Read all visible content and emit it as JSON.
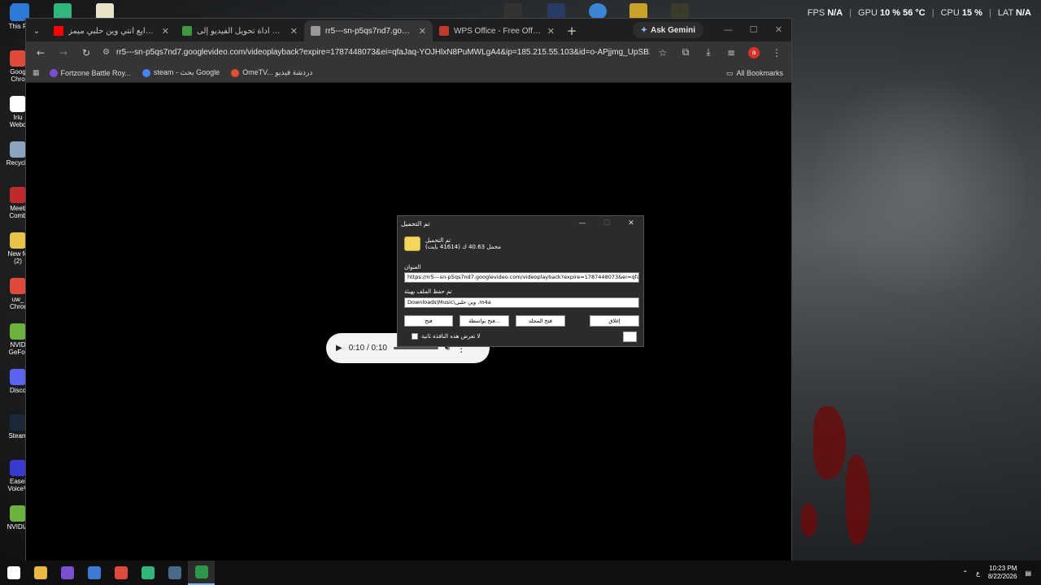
{
  "desktop": {
    "icons": [
      {
        "label": "This P",
        "icon": "pc-icon",
        "color": "#2d7bd6"
      },
      {
        "label": "Goog\nChro",
        "icon": "chrome-icon",
        "color": "#e04a3a"
      },
      {
        "label": "Iriu\nWebc",
        "icon": "webcam-icon",
        "color": "#ffffff"
      },
      {
        "label": "Recycle",
        "icon": "recycle-bin-icon",
        "color": "#8aa4c0"
      },
      {
        "label": "Meeti\nComb",
        "icon": "app-icon",
        "color": "#c02a2a"
      },
      {
        "label": "New fo\n(2)",
        "icon": "folder-icon",
        "color": "#e8c34a"
      },
      {
        "label": "uw_\nChror",
        "icon": "chrome-icon",
        "color": "#e04a3a"
      },
      {
        "label": "NVID\nGeFor",
        "icon": "nvidia-icon",
        "color": "#6cb33e"
      },
      {
        "label": "Disco",
        "icon": "discord-icon",
        "color": "#5865f2"
      },
      {
        "label": "Steam",
        "icon": "steam-icon",
        "color": "#1b2838"
      },
      {
        "label": "Easel\nVoiceV",
        "icon": "app-icon",
        "color": "#3a3ad0"
      },
      {
        "label": "NVIDIA",
        "icon": "nvidia-icon",
        "color": "#6cb33e"
      }
    ]
  },
  "overlay_stats": {
    "fps_label": "FPS",
    "fps_value": "N/A",
    "gpu_label": "GPU",
    "gpu_value": "10 % 56 °C",
    "cpu_label": "CPU",
    "cpu_value": "15 %",
    "lat_label": "LAT",
    "lat_value": "N/A"
  },
  "browser": {
    "tabs": [
      {
        "title": "ايع انتي وين حلبي ميمز😂😂🔥",
        "icon": "youtube-icon",
        "color": "#ff0000",
        "active": false
      },
      {
        "title": "أداة تحويل الفيديو إلى MP4 أونلاي",
        "icon": "converter-icon",
        "color": "#3c9a3c",
        "active": false
      },
      {
        "title": "rr5---sn-p5qs7nd7.googlevideo.",
        "icon": "globe-icon",
        "color": "#999999",
        "active": true
      },
      {
        "title": "WPS Office - Free Office Downl",
        "icon": "wps-icon",
        "color": "#c0392b",
        "active": false
      }
    ],
    "ask_gemini": "Ask Gemini",
    "url": "rr5---sn-p5qs7nd7.googlevideo.com/videoplayback?expire=1787448073&ei=qfaJaq-YOJHlxN8PuMWLgA4&ip=185.215.55.103&id=o-APjjmg_UpSBX9QfpH9...",
    "profile_initial": "a",
    "bookmarks": [
      {
        "label": "Fortzone Battle Roy...",
        "icon": "bookmark-icon",
        "color": "#7b4bd6"
      },
      {
        "label": "steam - بحث Google",
        "icon": "google-icon",
        "color": "#4285f4"
      },
      {
        "label": "OmeTV... دردشة فيديو",
        "icon": "ometv-icon",
        "color": "#e0502f"
      }
    ],
    "all_bookmarks": "All Bookmarks"
  },
  "player": {
    "time": "0:10 / 0:10"
  },
  "download_dialog": {
    "title": "تم التحميل",
    "status_line1": "تم التحميل",
    "status_line2": "محمل 40.63 ك (41614 بايت)",
    "address_label": "العنوان",
    "address_value": "https://rr5---sn-p5qs7nd7.googlevideo.com/videoplayback?expire=1787448073&ei=qfaJ",
    "saved_label": "تم حفظ الملف بهيئة",
    "saved_value": "Downloads\\Music\\وين حلبي .m4a",
    "btn_open": "فتح",
    "btn_open_with": "فتح بواسطة...",
    "btn_open_folder": "فتح المجلد",
    "btn_close": "إغلاق",
    "dont_show": "لا تعرض هذه النافذة ثانية"
  },
  "taskbar": {
    "apps": [
      {
        "icon": "windows-start-icon",
        "color": "#ffffff"
      },
      {
        "icon": "file-explorer-icon",
        "color": "#e8b93c"
      },
      {
        "icon": "app-icon",
        "color": "#7a4fd1"
      },
      {
        "icon": "app-icon",
        "color": "#3a7bd5"
      },
      {
        "icon": "chrome-icon",
        "color": "#e04a3a"
      },
      {
        "icon": "app-icon",
        "color": "#2fb67a"
      },
      {
        "icon": "steam-icon",
        "color": "#4a6a8a"
      },
      {
        "icon": "idm-icon",
        "color": "#2a9a4a"
      }
    ],
    "lang": "ع",
    "time": "10:23 PM",
    "date": "8/22/2026"
  }
}
